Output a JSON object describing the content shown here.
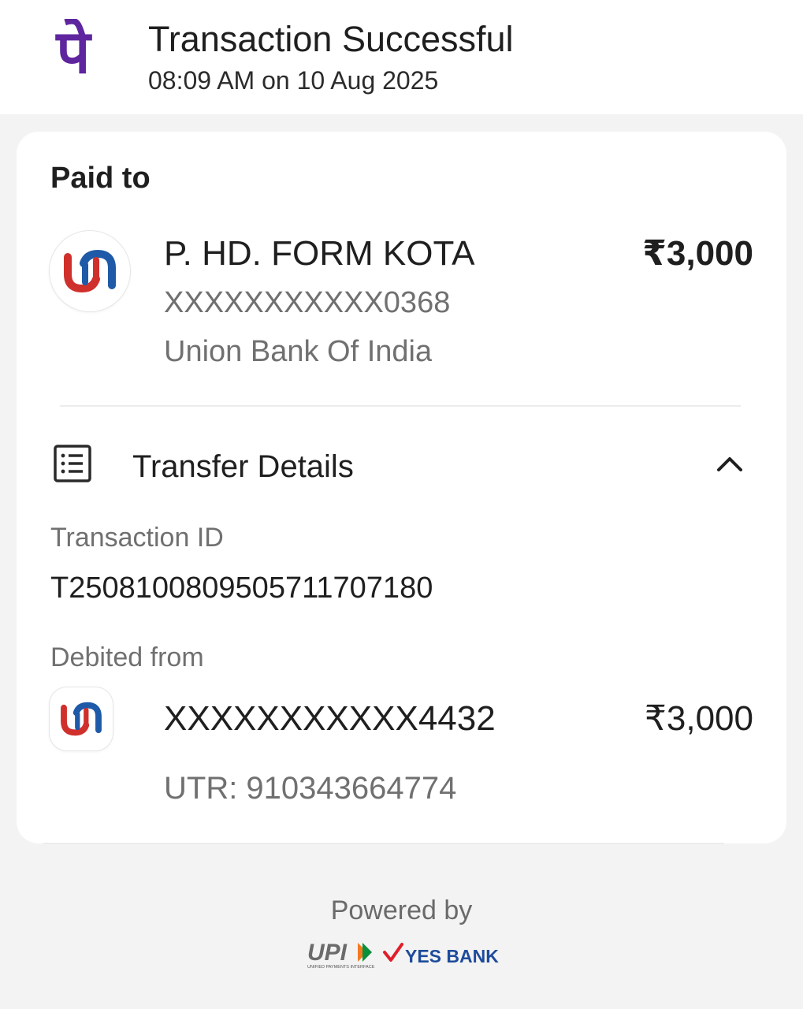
{
  "header": {
    "title": "Transaction Successful",
    "timestamp": "08:09 AM on 10 Aug 2025",
    "app_icon": "phonepe-logo",
    "brand_color": "#5f259f"
  },
  "payee": {
    "section_label": "Paid to",
    "name": "P. HD. FORM KOTA",
    "amount": "₹3,000",
    "account": "XXXXXXXXXXX0368",
    "bank": "Union Bank Of India",
    "bank_icon": "union-bank-logo"
  },
  "transfer_details": {
    "label": "Transfer Details",
    "icon": "receipt-list-icon",
    "toggle_icon": "chevron-up-icon",
    "transaction_id_label": "Transaction ID",
    "transaction_id": "T2508100809505711707180",
    "debited_label": "Debited from",
    "debit_account": "XXXXXXXXXXX4432",
    "debit_amount": "₹3,000",
    "utr": "UTR: 910343664774",
    "debit_bank_icon": "union-bank-logo"
  },
  "footer": {
    "powered_by": "Powered by",
    "upi_logo_text": "UPI",
    "upi_tagline": "UNIFIED PAYMENTS INTERFACE",
    "partner_bank": "YES BANK"
  },
  "colors": {
    "union_red": "#d0302c",
    "union_blue": "#1f5aa8",
    "yes_bank_blue": "#1d4b9b",
    "yes_bank_red": "#e11d2b"
  }
}
